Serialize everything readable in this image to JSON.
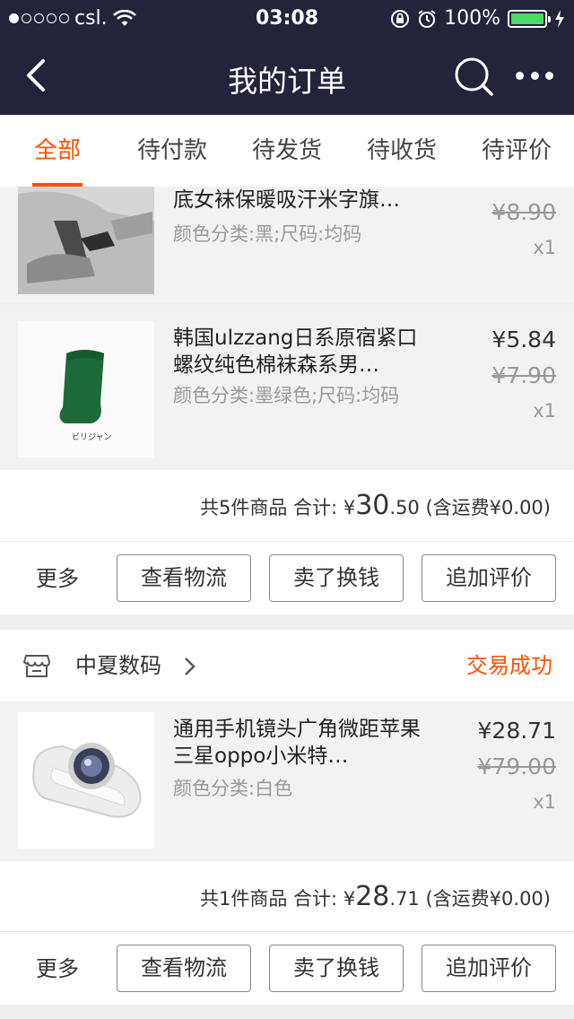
{
  "status_bar": {
    "carrier": "csl.",
    "time": "03:08",
    "battery": "100%",
    "battery_level": 1.0
  },
  "nav": {
    "title": "我的订单",
    "icons": [
      "back-arrow-icon",
      "search-icon",
      "more-icon"
    ]
  },
  "tabs": [
    {
      "label": "全部",
      "active": true
    },
    {
      "label": "待付款",
      "active": false
    },
    {
      "label": "待发货",
      "active": false
    },
    {
      "label": "待收货",
      "active": false
    },
    {
      "label": "待评价",
      "active": false
    }
  ],
  "order1": {
    "items": [
      {
        "name": "底女袜保暖吸汗米字旗…",
        "attr": "颜色分类:黑;尺码:均码",
        "old_price": "¥8.90",
        "qty": "x1"
      },
      {
        "name": "韩国ulzzang日系原宿紧口螺纹纯色棉袜森系男…",
        "attr": "颜色分类:墨绿色;尺码:均码",
        "price": "¥5.84",
        "old_price": "¥7.90",
        "qty": "x1",
        "thumb_caption": "ビリジャン"
      }
    ],
    "summary": {
      "count_text": "共5件商品 合计:",
      "currency": "¥",
      "total_int": "30",
      "total_dec": ".50",
      "shipping": "(含运费¥0.00)"
    },
    "actions": {
      "more": "更多",
      "buttons": [
        "查看物流",
        "卖了换钱",
        "追加评价"
      ]
    }
  },
  "order2": {
    "shop": {
      "name": "中夏数码",
      "status": "交易成功"
    },
    "items": [
      {
        "name": "通用手机镜头广角微距苹果三星oppo小米特…",
        "attr": "颜色分类:白色",
        "price": "¥28.71",
        "old_price": "¥79.00",
        "qty": "x1"
      }
    ],
    "summary": {
      "count_text": "共1件商品 合计:",
      "currency": "¥",
      "total_int": "28",
      "total_dec": ".71",
      "shipping": "(含运费¥0.00)"
    },
    "actions": {
      "more": "更多",
      "buttons": [
        "查看物流",
        "卖了换钱",
        "追加评价"
      ]
    }
  },
  "colors": {
    "nav_bg": "#23243c",
    "accent": "#ff5000",
    "battery": "#4cd964"
  }
}
